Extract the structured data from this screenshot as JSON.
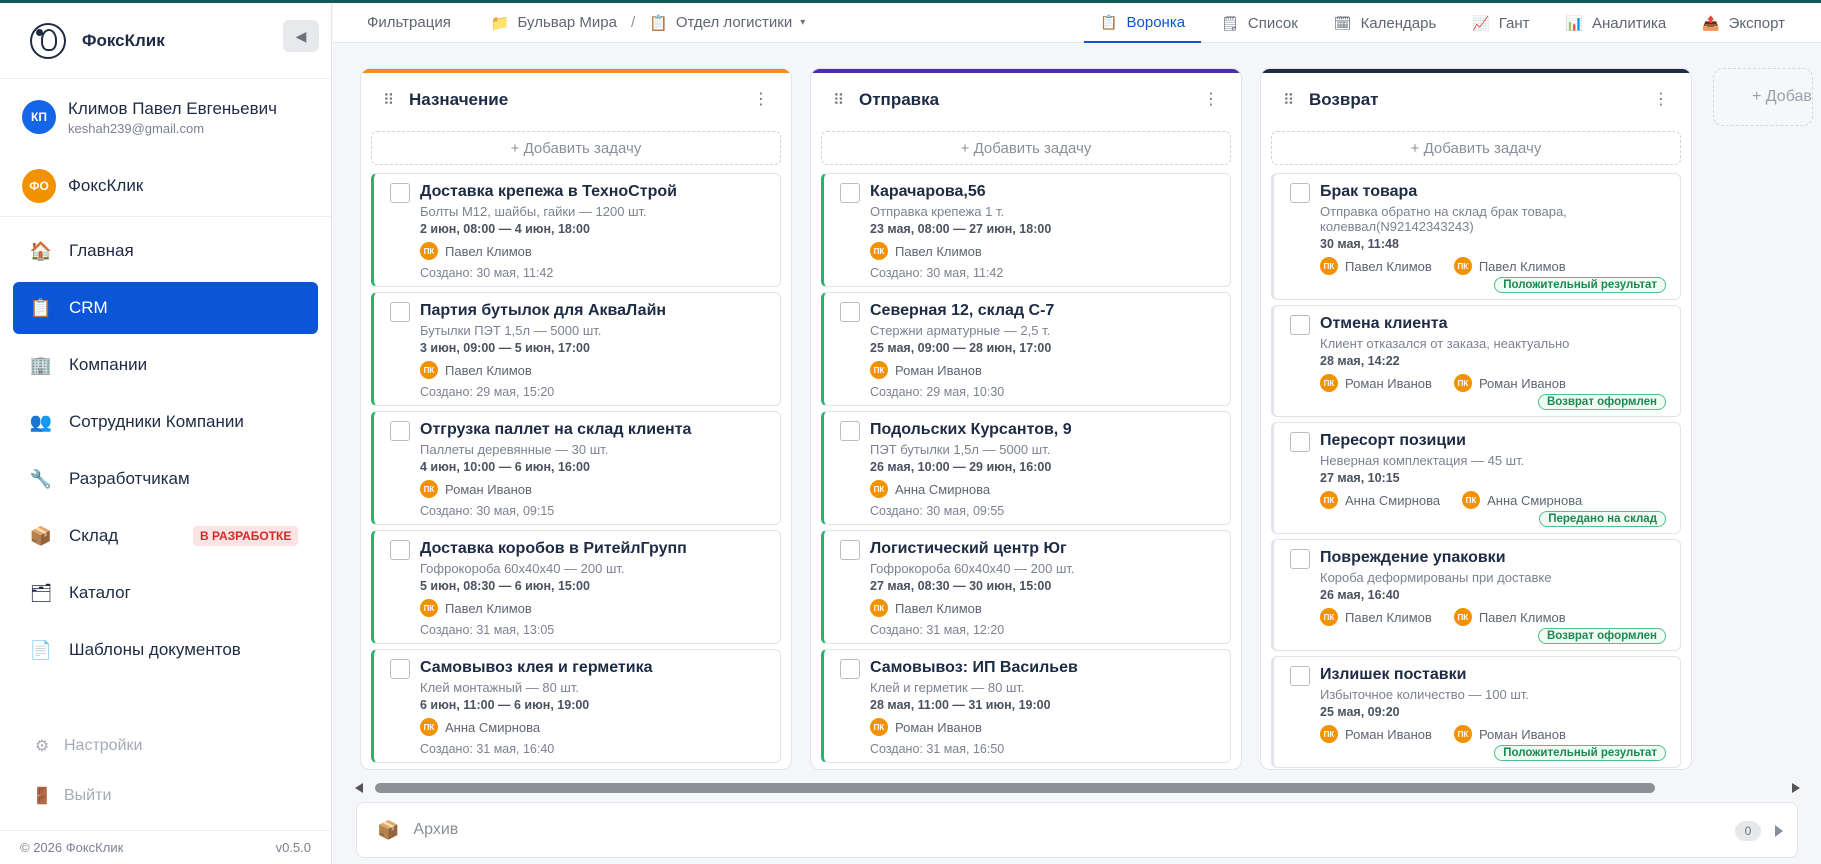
{
  "brand": {
    "name": "ФоксКлик"
  },
  "account": {
    "initials": "КП",
    "name": "Климов Павел Евгеньевич",
    "email": "keshah239@gmail.com"
  },
  "org": {
    "initials": "ФО",
    "name": "ФоксКлик"
  },
  "nav": [
    {
      "label": "Главная",
      "icon": "home-icon"
    },
    {
      "label": "CRM",
      "icon": "clipboard-icon",
      "active": true
    },
    {
      "label": "Компании",
      "icon": "building-icon"
    },
    {
      "label": "Сотрудники Компании",
      "icon": "people-icon"
    },
    {
      "label": "Разработчикам",
      "icon": "wrench-icon"
    },
    {
      "label": "Склад",
      "icon": "box-icon",
      "badge": "В РАЗРАБОТКЕ"
    },
    {
      "label": "Каталог",
      "icon": "folder-icon"
    },
    {
      "label": "Шаблоны документов",
      "icon": "document-icon"
    }
  ],
  "nav_secondary": [
    {
      "label": "Настройки",
      "icon": "gear-icon"
    },
    {
      "label": "Выйти",
      "icon": "door-icon"
    }
  ],
  "footer": {
    "copyright": "© 2026 ФоксКлик",
    "version": "v0.5.0"
  },
  "topbar": {
    "filter": "Фильтрация",
    "crumb1": "Бульвар Мира",
    "separator": "/",
    "crumb2": "Отдел логистики",
    "views": [
      "Воронка",
      "Список",
      "Календарь",
      "Гант",
      "Аналитика",
      "Экспорт"
    ],
    "active_view": "Воронка"
  },
  "board": {
    "add_task_label": "+ Добавить задачу",
    "add_column_label": "+ Добавить",
    "columns": [
      {
        "title": "Назначение",
        "cards": [
          {
            "title": "Доставка крепежа в ТехноСтрой",
            "desc": "Болты М12, шайбы, гайки — 1200 шт.",
            "time": "2 июн, 08:00 — 4 июн, 18:00",
            "person": "Павел Климов",
            "created": "Создано: 30 мая, 11:42"
          },
          {
            "title": "Партия бутылок для АкваЛайн",
            "desc": "Бутылки ПЭТ 1,5л — 5000 шт.",
            "time": "3 июн, 09:00 — 5 июн, 17:00",
            "person": "Павел Климов",
            "created": "Создано: 29 мая, 15:20"
          },
          {
            "title": "Отгрузка паллет на склад клиента",
            "desc": "Паллеты деревянные — 30 шт.",
            "time": "4 июн, 10:00 — 6 июн, 16:00",
            "person": "Роман Иванов",
            "created": "Создано: 30 мая, 09:15"
          },
          {
            "title": "Доставка коробов в РитейлГрупп",
            "desc": "Гофрокороба 60х40х40 — 200 шт.",
            "time": "5 июн, 08:30 — 6 июн, 15:00",
            "person": "Павел Климов",
            "created": "Создано: 31 мая, 13:05"
          },
          {
            "title": "Самовывоз клея и герметика",
            "desc": "Клей монтажный — 80 шт.",
            "time": "6 июн, 11:00 — 6 июн, 19:00",
            "person": "Анна Смирнова",
            "created": "Создано: 31 мая, 16:40"
          }
        ]
      },
      {
        "title": "Отправка",
        "cards": [
          {
            "title": "Карачарова,56",
            "desc": "Отправка крепежа 1 т.",
            "time": "23 мая, 08:00 — 27 июн, 18:00",
            "person": "Павел Климов",
            "created": "Создано: 30 мая, 11:42"
          },
          {
            "title": "Северная 12, склад С-7",
            "desc": "Стержни арматурные — 2,5 т.",
            "time": "25 мая, 09:00 — 28 июн, 17:00",
            "person": "Роман Иванов",
            "created": "Создано: 29 мая, 10:30"
          },
          {
            "title": "Подольских Курсантов, 9",
            "desc": "ПЭТ бутылки 1,5л — 5000 шт.",
            "time": "26 мая, 10:00 — 29 июн, 16:00",
            "person": "Анна Смирнова",
            "created": "Создано: 30 мая, 09:55"
          },
          {
            "title": "Логистический центр Юг",
            "desc": "Гофрокороба 60х40х40 — 200 шт.",
            "time": "27 мая, 08:30 — 30 июн, 15:00",
            "person": "Павел Климов",
            "created": "Создано: 31 мая, 12:20"
          },
          {
            "title": "Самовывоз: ИП Васильев",
            "desc": "Клей и герметик — 80 шт.",
            "time": "28 мая, 11:00 — 31 июн, 19:00",
            "person": "Роман Иванов",
            "created": "Создано: 31 мая, 16:50"
          }
        ]
      },
      {
        "title": "Возврат",
        "cards": [
          {
            "title": "Брак товара",
            "desc": "Отправка обратно на склад брак товара, колеввал(N92142343243)",
            "time": "30 мая, 11:48",
            "person1": "Павел Климов",
            "person2": "Павел Климов",
            "status": "Положительный результат"
          },
          {
            "title": "Отмена клиента",
            "desc": "Клиент отказался от заказа, неактуально",
            "time": "28 мая, 14:22",
            "person1": "Роман Иванов",
            "person2": "Роман Иванов",
            "status": "Возврат оформлен"
          },
          {
            "title": "Пересорт позиции",
            "desc": "Неверная комплектация — 45 шт.",
            "time": "27 мая, 10:15",
            "person1": "Анна Смирнова",
            "person2": "Анна Смирнова",
            "status": "Передано на склад"
          },
          {
            "title": "Повреждение упаковки",
            "desc": "Короба деформированы при доставке",
            "time": "26 мая, 16:40",
            "person1": "Павел Климов",
            "person2": "Павел Климов",
            "status": "Возврат оформлен"
          },
          {
            "title": "Излишек поставки",
            "desc": "Избыточное количество — 100 шт.",
            "time": "25 мая, 09:20",
            "person1": "Роман Иванов",
            "person2": "Роман Иванов",
            "status": "Положительный результат"
          }
        ]
      }
    ]
  },
  "archive": {
    "label": "Архив",
    "count": "0"
  },
  "colors": {
    "accent": "#0a56d6",
    "orange": "#f68b1f",
    "purple": "#4b2ea3",
    "navy": "#1d2b44",
    "green": "#26b36a"
  }
}
